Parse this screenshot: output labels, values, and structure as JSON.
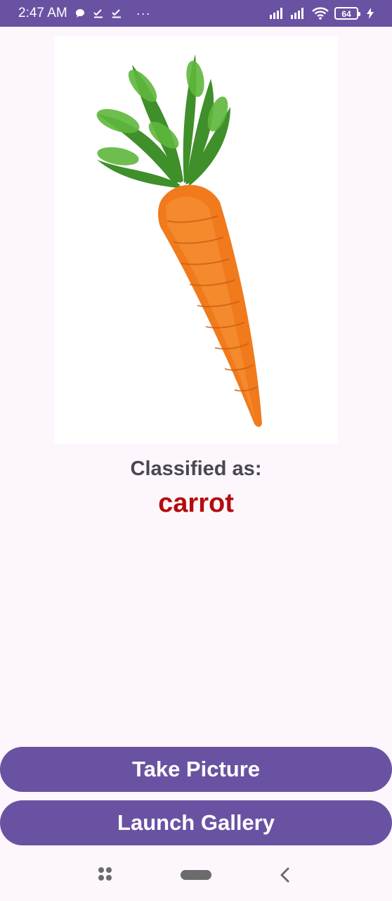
{
  "status_bar": {
    "time": "2:47 AM",
    "notification_icons": [
      "chat-bubble-icon",
      "download-done-icon",
      "download-done-icon",
      "more-dots-icon"
    ],
    "more": "···",
    "battery_level": "64",
    "indicator_icons": [
      "signal-icon",
      "signal-icon",
      "wifi-icon",
      "battery-icon",
      "charging-icon"
    ]
  },
  "image": {
    "subject": "carrot-photo"
  },
  "result": {
    "label": "Classified as:",
    "value": "carrot"
  },
  "buttons": {
    "take_picture": "Take Picture",
    "launch_gallery": "Launch Gallery"
  },
  "nav_bar": {
    "icons": [
      "recent-apps-icon",
      "home-pill-icon",
      "back-icon"
    ]
  },
  "colors": {
    "accent": "#6a52a3",
    "result": "#b30c0c",
    "label": "#4a4750",
    "background": "#fdf7fd"
  }
}
